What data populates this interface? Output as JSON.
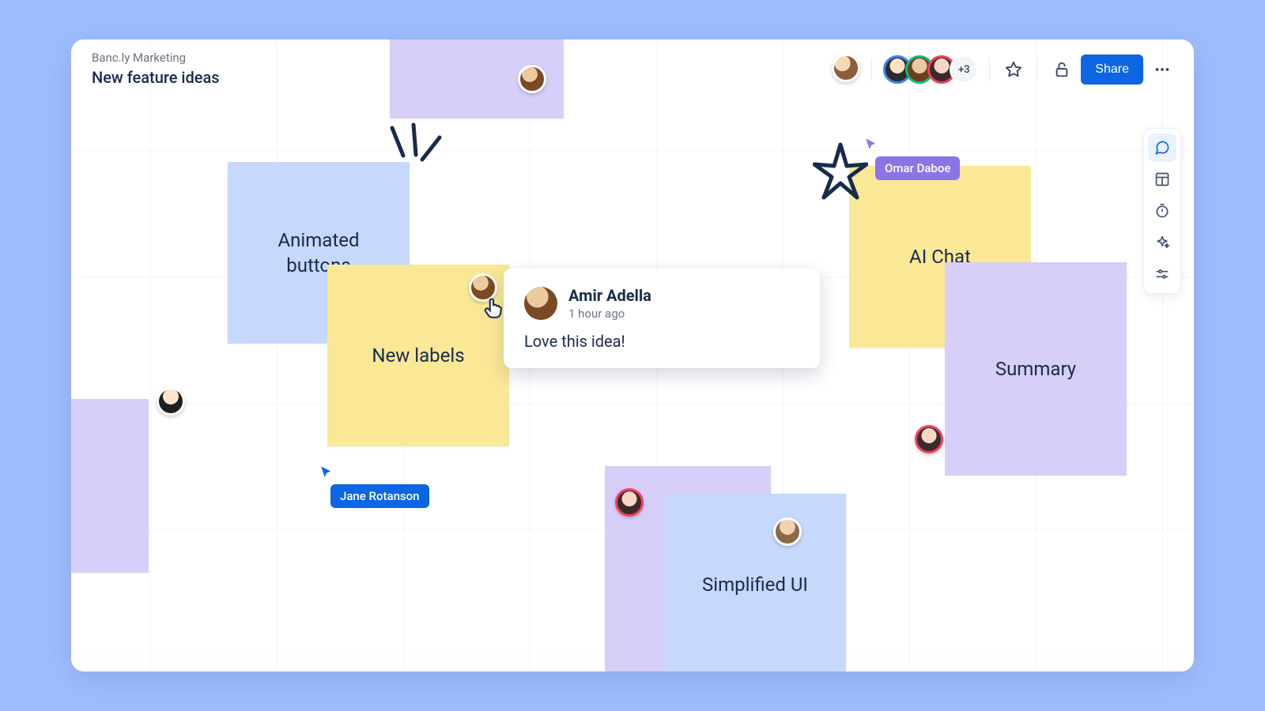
{
  "header": {
    "workspace": "Banc.ly Marketing",
    "title": "New feature ideas"
  },
  "topbar": {
    "overflow_count": "+3",
    "share_label": "Share",
    "participants": [
      {
        "id": "p1",
        "ring": "none"
      },
      {
        "id": "p2",
        "ring": "blue"
      },
      {
        "id": "p3",
        "ring": "green"
      },
      {
        "id": "p4",
        "ring": "pink"
      }
    ],
    "icons": {
      "star": "star-icon",
      "lock": "lock-open-icon",
      "more": "more-icon"
    }
  },
  "notes": {
    "animated_buttons": "Animated buttons",
    "new_labels": "New labels",
    "ai_chat": "AI Chat",
    "summary": "Summary",
    "simplified_ui": "Simplified UI"
  },
  "cursors": {
    "jane": "Jane Rotanson",
    "omar": "Omar Daboe"
  },
  "comment": {
    "author": "Amir Adella",
    "time": "1 hour ago",
    "body": "Love this idea!"
  },
  "toolbar": {
    "items": [
      {
        "name": "comment-tool",
        "active": true
      },
      {
        "name": "template-tool",
        "active": false
      },
      {
        "name": "timer-tool",
        "active": false
      },
      {
        "name": "ai-tool",
        "active": false
      },
      {
        "name": "settings-tool",
        "active": false
      }
    ]
  },
  "colors": {
    "accent": "#0c66e4",
    "purple": "#8a74e8",
    "note_blue": "#c6d8fb",
    "note_yellow": "#fbe896",
    "note_purple": "#d7cefa"
  }
}
